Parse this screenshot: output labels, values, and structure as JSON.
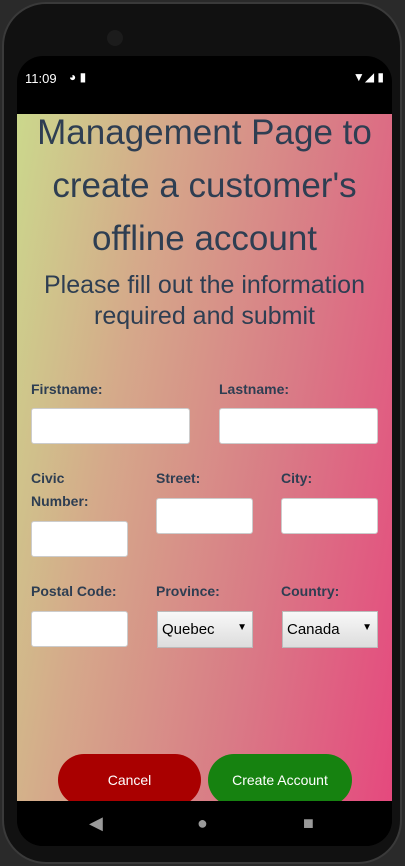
{
  "status_bar": {
    "time": "11:09",
    "left_icons": [
      "sync-icon",
      "sd-card-icon"
    ],
    "right_icons": [
      "wifi-icon",
      "signal-icon",
      "battery-icon"
    ]
  },
  "page": {
    "title": "Management Page to create a customer's offline account",
    "subtitle": "Please fill out the information required and submit"
  },
  "form": {
    "firstname": {
      "label": "Firstname:",
      "value": ""
    },
    "lastname": {
      "label": "Lastname:",
      "value": ""
    },
    "civic_number": {
      "label": "Civic Number:",
      "value": ""
    },
    "street": {
      "label": "Street:",
      "value": ""
    },
    "city": {
      "label": "City:",
      "value": ""
    },
    "postal_code": {
      "label": "Postal Code:",
      "value": ""
    },
    "province": {
      "label": "Province:",
      "selected": "Quebec"
    },
    "country": {
      "label": "Country:",
      "selected": "Canada"
    }
  },
  "buttons": {
    "cancel": "Cancel",
    "create": "Create Account",
    "cancel_color": "#a90000",
    "create_color": "#168210"
  },
  "nav_bar": {
    "icons": [
      "back-icon",
      "home-icon",
      "recents-icon"
    ]
  }
}
